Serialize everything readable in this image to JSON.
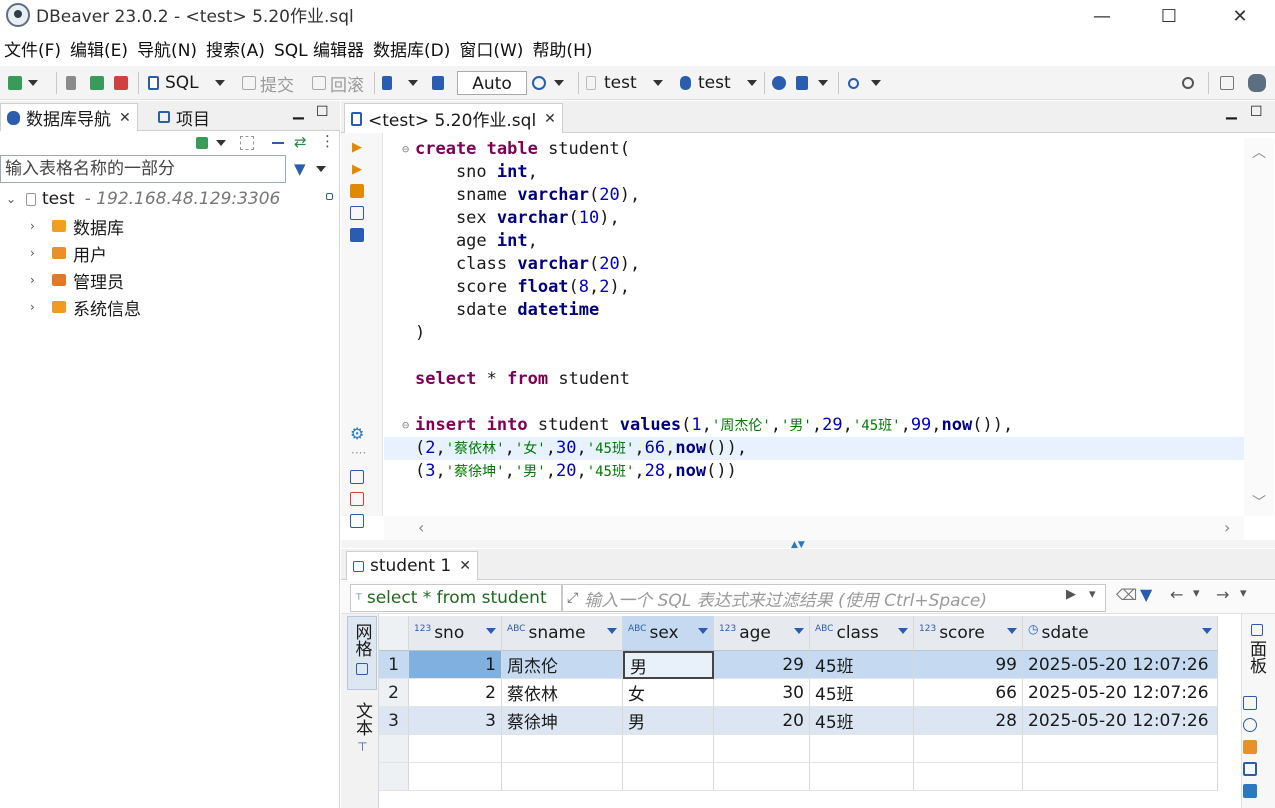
{
  "window": {
    "title": "DBeaver 23.0.2 - <test> 5.20作业.sql",
    "minimize": "—",
    "maximize": "☐",
    "close": "✕"
  },
  "menu": [
    "文件(F)",
    "编辑(E)",
    "导航(N)",
    "搜索(A)",
    "SQL 编辑器",
    "数据库(D)",
    "窗口(W)",
    "帮助(H)"
  ],
  "toolbar": {
    "sql_label": "SQL",
    "commit_label": "提交",
    "rollback_label": "回滚",
    "auto_label": "Auto",
    "datasource_label": "test",
    "schema_label": "test"
  },
  "navigator": {
    "tab_label": "数据库导航",
    "projects_tab_label": "项目",
    "filter_placeholder": "输入表格名称的一部分",
    "connection": {
      "name": "test",
      "host": "- 192.168.48.129:3306"
    },
    "items": [
      {
        "label": "数据库",
        "color": "#f0a020"
      },
      {
        "label": "用户",
        "color": "#e8902a"
      },
      {
        "label": "管理员",
        "color": "#e07a2a"
      },
      {
        "label": "系统信息",
        "color": "#f09a20"
      }
    ]
  },
  "editor": {
    "tab_label": "<test> 5.20作业.sql"
  },
  "results": {
    "tab_label": "student 1",
    "query_text": "select * from student",
    "filter_placeholder": "输入一个 SQL 表达式来过滤结果 (使用 Ctrl+Space)",
    "grid_tab": "网格",
    "text_tab": "文本",
    "panel_tab": "面板",
    "columns": [
      {
        "type": "123",
        "name": "sno"
      },
      {
        "type": "ABC",
        "name": "sname"
      },
      {
        "type": "ABC",
        "name": "sex"
      },
      {
        "type": "123",
        "name": "age"
      },
      {
        "type": "ABC",
        "name": "class"
      },
      {
        "type": "123",
        "name": "score"
      },
      {
        "type": "◷",
        "name": "sdate"
      }
    ],
    "rows": [
      {
        "num": "1",
        "sno": "1",
        "sname": "周杰伦",
        "sex": "男",
        "age": "29",
        "class": "45班",
        "score": "99",
        "sdate": "2025-05-20 12:07:26"
      },
      {
        "num": "2",
        "sno": "2",
        "sname": "蔡依林",
        "sex": "女",
        "age": "30",
        "class": "45班",
        "score": "66",
        "sdate": "2025-05-20 12:07:26"
      },
      {
        "num": "3",
        "sno": "3",
        "sname": "蔡徐坤",
        "sex": "男",
        "age": "20",
        "class": "45班",
        "score": "28",
        "sdate": "2025-05-20 12:07:26"
      }
    ]
  }
}
